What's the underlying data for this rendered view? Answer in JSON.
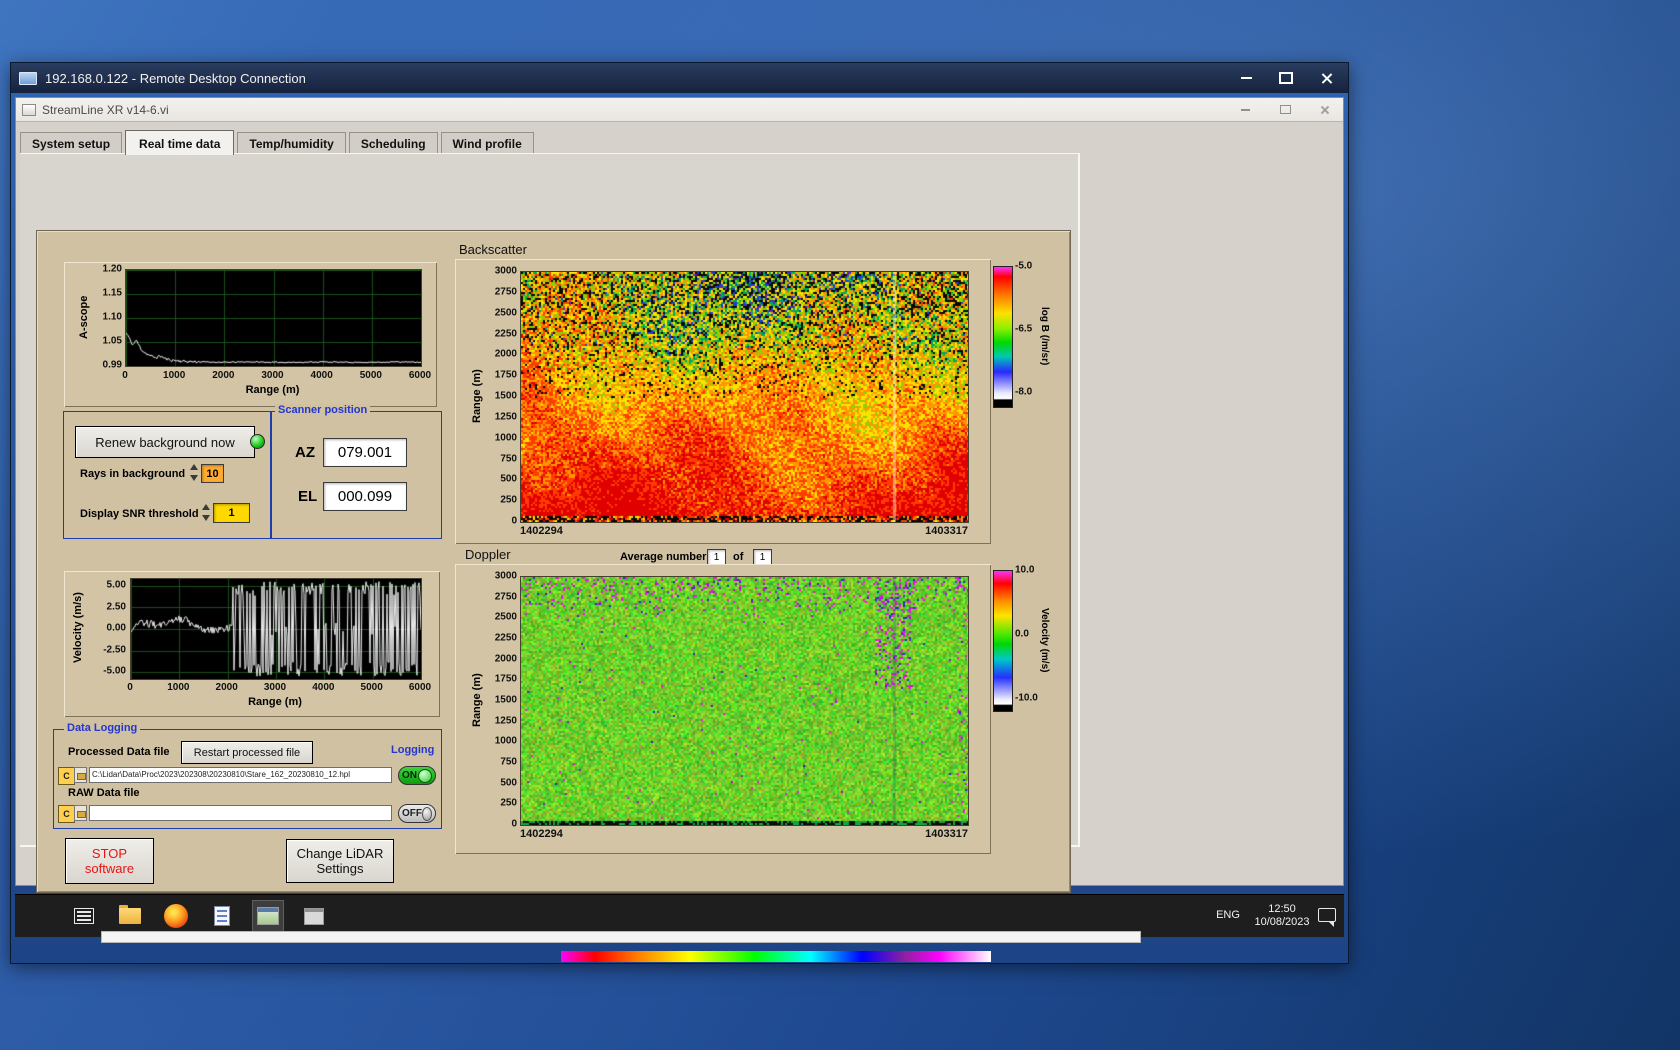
{
  "rdp": {
    "title": "192.168.0.122 - Remote Desktop Connection"
  },
  "app": {
    "title": "StreamLine XR v14-6.vi"
  },
  "tabs": [
    {
      "label": "System setup"
    },
    {
      "label": "Real time data"
    },
    {
      "label": "Temp/humidity"
    },
    {
      "label": "Scheduling"
    },
    {
      "label": "Wind profile"
    }
  ],
  "active_tab": "Real time data",
  "background_ctrl": {
    "renew_button": "Renew background now",
    "rays_label": "Rays in background",
    "rays_value": "10",
    "snr_label": "Display SNR threshold",
    "snr_value": "1"
  },
  "scanner": {
    "title": "Scanner position",
    "az_label": "AZ",
    "az_value": "079.001",
    "el_label": "EL",
    "el_value": "000.099"
  },
  "average": {
    "label": "Average number",
    "value": "1",
    "of": "of",
    "total": "1"
  },
  "logging": {
    "title": "Data Logging",
    "processed_label": "Processed Data file",
    "restart_button": "Restart processed file",
    "logging_label": "Logging",
    "drive": "C",
    "processed_path": "C:\\Lidar\\Data\\Proc\\2023\\202308\\20230810\\Stare_162_20230810_12.hpl",
    "on_label": "ON",
    "raw_label": "RAW Data file",
    "raw_path": "",
    "off_label": "OFF"
  },
  "actions": {
    "stop_line1": "STOP",
    "stop_line2": "software",
    "change_line1": "Change LiDAR",
    "change_line2": "Settings"
  },
  "taskbar": {
    "lang": "ENG",
    "time": "12:50",
    "date": "10/08/2023"
  },
  "icons": [
    "computer-icon",
    "minimize-icon",
    "maximize-icon",
    "close-icon",
    "task-view-icon",
    "file-explorer-icon",
    "firefox-icon",
    "notepad-icon",
    "remote-app-icon",
    "scan-app-icon",
    "notification-icon"
  ],
  "chart_data": [
    {
      "id": "ascope",
      "type": "line",
      "title": "",
      "ylabel": "A-scope",
      "xlabel": "Range (m)",
      "xlim": [
        0,
        6000
      ],
      "ylim": [
        0.99,
        1.2
      ],
      "yticks": [
        "1.20",
        "1.15",
        "1.10",
        "1.05",
        "0.99"
      ],
      "xticks": [
        "0",
        "1000",
        "2000",
        "3000",
        "4000",
        "5000",
        "6000"
      ],
      "x": [
        0,
        50,
        100,
        150,
        200,
        250,
        300,
        350,
        400,
        500,
        600,
        700,
        800,
        900,
        1000,
        1200,
        1500,
        2000,
        2500,
        3000,
        3500,
        4000,
        4500,
        5000,
        5500,
        6000
      ],
      "y": [
        1.062,
        1.055,
        1.042,
        1.036,
        1.047,
        1.038,
        1.028,
        1.022,
        1.018,
        1.012,
        1.008,
        1.012,
        1.006,
        1.003,
        1.002,
        1.0,
        0.999,
        0.998,
        0.999,
        0.998,
        0.998,
        0.999,
        0.998,
        0.998,
        0.999,
        0.998
      ],
      "grid": true
    },
    {
      "id": "backscatter",
      "type": "heatmap",
      "title": "Backscatter",
      "ylabel": "Range (m)",
      "ylim": [
        0,
        3000
      ],
      "yticks": [
        "3000",
        "2750",
        "2500",
        "2250",
        "2000",
        "1750",
        "1500",
        "1250",
        "1000",
        "750",
        "500",
        "250",
        "0"
      ],
      "xticks": [
        "1402294",
        "1403317"
      ],
      "colorbar": {
        "label": "log B (/m/sr)",
        "ticks": [
          "-5.0",
          "-6.5",
          "-8.0"
        ],
        "range": [
          -5.0,
          -8.0
        ]
      },
      "description": "Time-height backscatter curtain: strong red returns below ~750 m, orange/yellow aloft, speckled noise above ~2000 m, pale vertical data gap near right side"
    },
    {
      "id": "velocity",
      "type": "line",
      "title": "",
      "ylabel": "Velocity (m/s)",
      "xlabel": "Range (m)",
      "xlim": [
        0,
        6000
      ],
      "ylim": [
        -5,
        5
      ],
      "yticks": [
        "5.00",
        "2.50",
        "0.00",
        "-2.50",
        "-5.00"
      ],
      "xticks": [
        "0",
        "1000",
        "2000",
        "3000",
        "4000",
        "5000",
        "6000"
      ],
      "segments": [
        {
          "x0": 0,
          "x1": 2100,
          "type": "coherent",
          "amplitude": 1.5
        },
        {
          "x0": 2100,
          "x1": 6000,
          "type": "noise-saturated",
          "amplitude": 5
        }
      ],
      "grid": true
    },
    {
      "id": "doppler",
      "type": "heatmap",
      "title": "Doppler",
      "ylabel": "Range (m)",
      "ylim": [
        0,
        3000
      ],
      "yticks": [
        "3000",
        "2750",
        "2500",
        "2250",
        "2000",
        "1750",
        "1500",
        "1250",
        "1000",
        "750",
        "500",
        "250",
        "0"
      ],
      "xticks": [
        "1402294",
        "1403317"
      ],
      "colorbar": {
        "label": "Velocity (m/s)",
        "ticks": [
          "10.0",
          "0.0",
          "-10.0"
        ],
        "range": [
          10,
          -10
        ]
      },
      "description": "Time-height Doppler velocity curtain: near-zero velocity (green) everywhere with magenta noise speckle above ~2500 m and in a column near the right side"
    }
  ]
}
